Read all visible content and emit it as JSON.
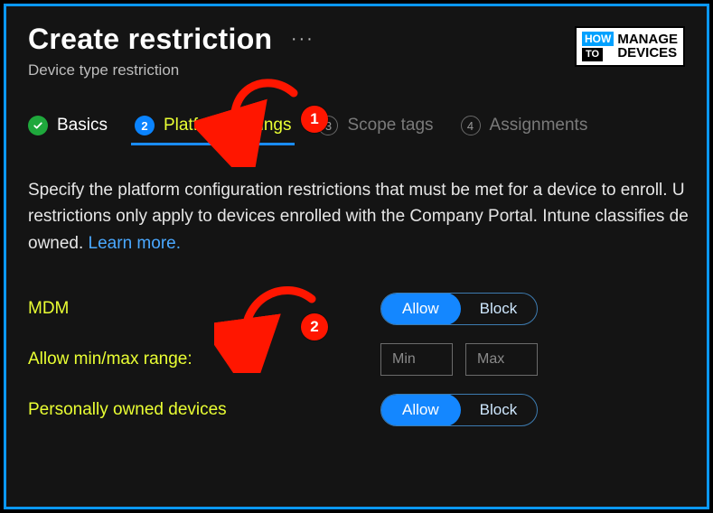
{
  "header": {
    "title": "Create restriction",
    "subtitle": "Device type restriction"
  },
  "tabs": {
    "basics": {
      "label": "Basics"
    },
    "platform": {
      "num": "2",
      "label": "Platform settings"
    },
    "scope": {
      "num": "3",
      "label": "Scope tags"
    },
    "assignments": {
      "num": "4",
      "label": "Assignments"
    }
  },
  "description": {
    "line1": "Specify the platform configuration restrictions that must be met for a device to enroll. U",
    "line2": "restrictions only apply to devices enrolled with the Company Portal. Intune classifies de",
    "line3_prefix": "owned. ",
    "learn_more": "Learn more."
  },
  "form": {
    "mdm": {
      "label": "MDM",
      "allow": "Allow",
      "block": "Block"
    },
    "range": {
      "label": "Allow min/max range:",
      "min_placeholder": "Min",
      "max_placeholder": "Max"
    },
    "personal": {
      "label": "Personally owned devices",
      "allow": "Allow",
      "block": "Block"
    }
  },
  "annotations": {
    "badge1": "1",
    "badge2": "2"
  },
  "watermark": {
    "how": "HOW",
    "to": "TO",
    "manage": "MANAGE",
    "devices": "DEVICES"
  }
}
